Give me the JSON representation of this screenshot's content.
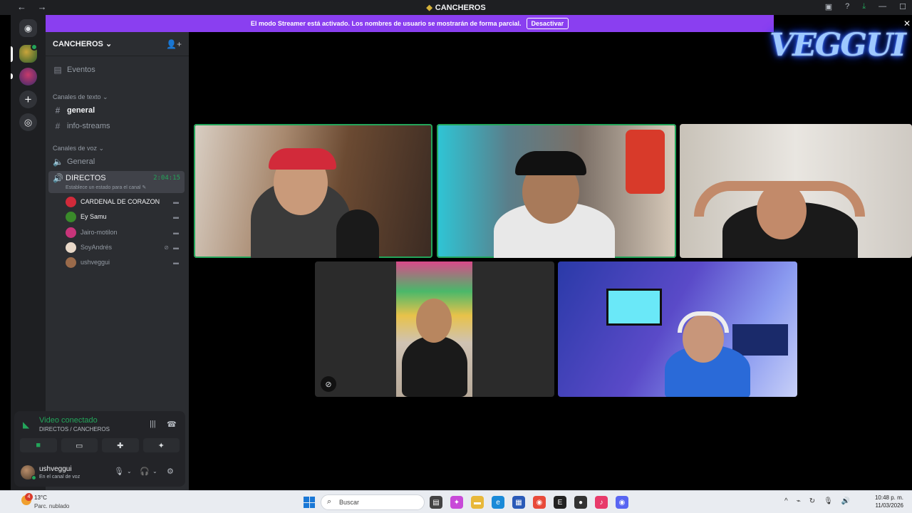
{
  "window": {
    "title": "CANCHEROS",
    "nav": "← →"
  },
  "banner": {
    "text": "El modo Streamer está activado. Los nombres de usuario se mostrarán de forma parcial.",
    "button": "Desactivar"
  },
  "overlay_logo": "VEGGUI",
  "server": {
    "name": "CANCHEROS",
    "events_label": "Eventos",
    "text_category": "Canales de texto",
    "text_channels": [
      "general",
      "info-streams"
    ],
    "voice_category": "Canales de voz",
    "voice_channels": [
      "General",
      "DIRECTOS"
    ],
    "active_voice": {
      "name": "DIRECTOS",
      "timer": "2:04:15",
      "status": "Establece un estado para el canal"
    },
    "members": [
      {
        "name": "CARDENAL DE CORAZON",
        "color": "#d12a3a"
      },
      {
        "name": "Ey Samu",
        "color": "#3a8a2a"
      },
      {
        "name": "Jairo-motilon",
        "color": "#c8347a"
      },
      {
        "name": "SoyAndrés",
        "color": "#e8d8c8"
      },
      {
        "name": "ushveggui",
        "color": "#9a6a4a"
      }
    ]
  },
  "voice_panel": {
    "title": "Video conectado",
    "subtitle": "DIRECTOS / CANCHEROS",
    "user": {
      "name": "ushveggui",
      "status": "En el canal de voz"
    }
  },
  "taskbar": {
    "weather_badge": "4",
    "temp": "13°C",
    "condition": "Parc. nublado",
    "search_placeholder": "Buscar",
    "time": "10:48 p. m.",
    "date": "11/03/2026"
  },
  "colors": {
    "accent": "#8a3ff0",
    "speaking": "#23a55a",
    "sidebar": "#2b2d31"
  }
}
